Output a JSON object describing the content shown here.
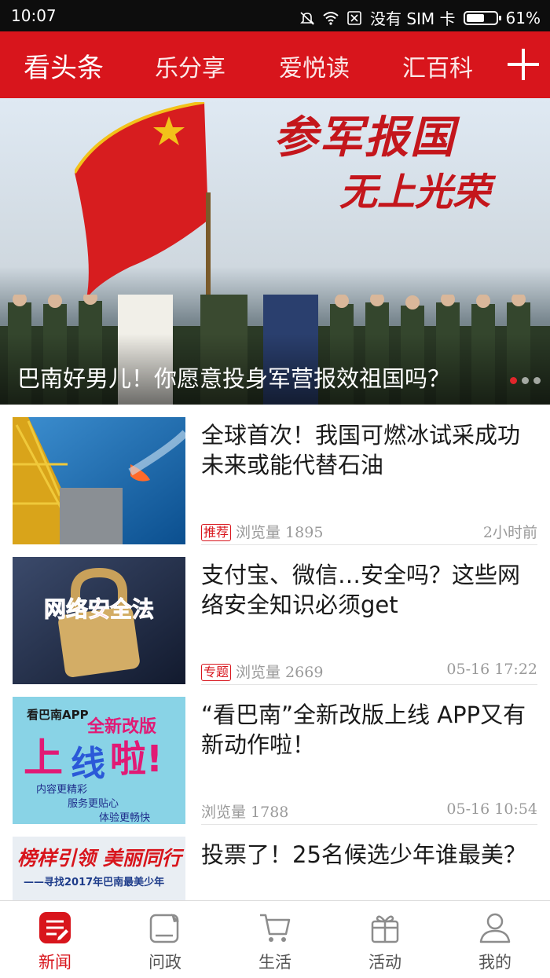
{
  "status_bar": {
    "time": "10:07",
    "sim": "没有 SIM 卡",
    "battery": "61%",
    "battery_level": 0.61
  },
  "nav": {
    "tabs": [
      {
        "label": "看头条"
      },
      {
        "label": "乐分享"
      },
      {
        "label": "爱悦读"
      },
      {
        "label": "汇百科"
      }
    ],
    "add_icon": "plus-icon"
  },
  "banner": {
    "slogan_line1": "参军报国",
    "slogan_line2": "无上光荣",
    "caption": "巴南好男儿！你愿意投身军营报效祖国吗？",
    "page_count": 3,
    "active_page": 1
  },
  "feed": [
    {
      "title": "全球首次！我国可燃冰试采成功 未来或能代替石油",
      "tag": "推荐",
      "views": "浏览量 1895",
      "time": "2小时前"
    },
    {
      "title": "支付宝、微信…安全吗？这些网络安全知识必须get",
      "tag": "专题",
      "views": "浏览量 2669",
      "time": "05-16 17:22",
      "thumb_text": "网络安全法"
    },
    {
      "title": "“看巴南”全新改版上线 APP又有新动作啦！",
      "tag": "",
      "views": "浏览量 1788",
      "time": "05-16 10:54",
      "thumb": {
        "brand": "看巴南APP",
        "line1": "全新改版",
        "big1": "上",
        "big2": "线",
        "big3": "啦!",
        "sub1": "内容更精彩",
        "sub2": "服务更贴心",
        "sub3": "体验更畅快"
      }
    },
    {
      "title": "投票了！25名候选少年谁最美？",
      "thumb": {
        "line1": "榜样引领 美丽同行",
        "line2": "——寻找2017年巴南最美少年"
      }
    }
  ],
  "tabbar": [
    {
      "label": "新闻",
      "icon": "news-icon"
    },
    {
      "label": "问政",
      "icon": "inquiry-icon"
    },
    {
      "label": "生活",
      "icon": "cart-icon"
    },
    {
      "label": "活动",
      "icon": "gift-icon"
    },
    {
      "label": "我的",
      "icon": "profile-icon"
    }
  ],
  "colors": {
    "accent": "#d8151c",
    "text": "#1a1a1a",
    "meta": "#9a9a9a"
  }
}
